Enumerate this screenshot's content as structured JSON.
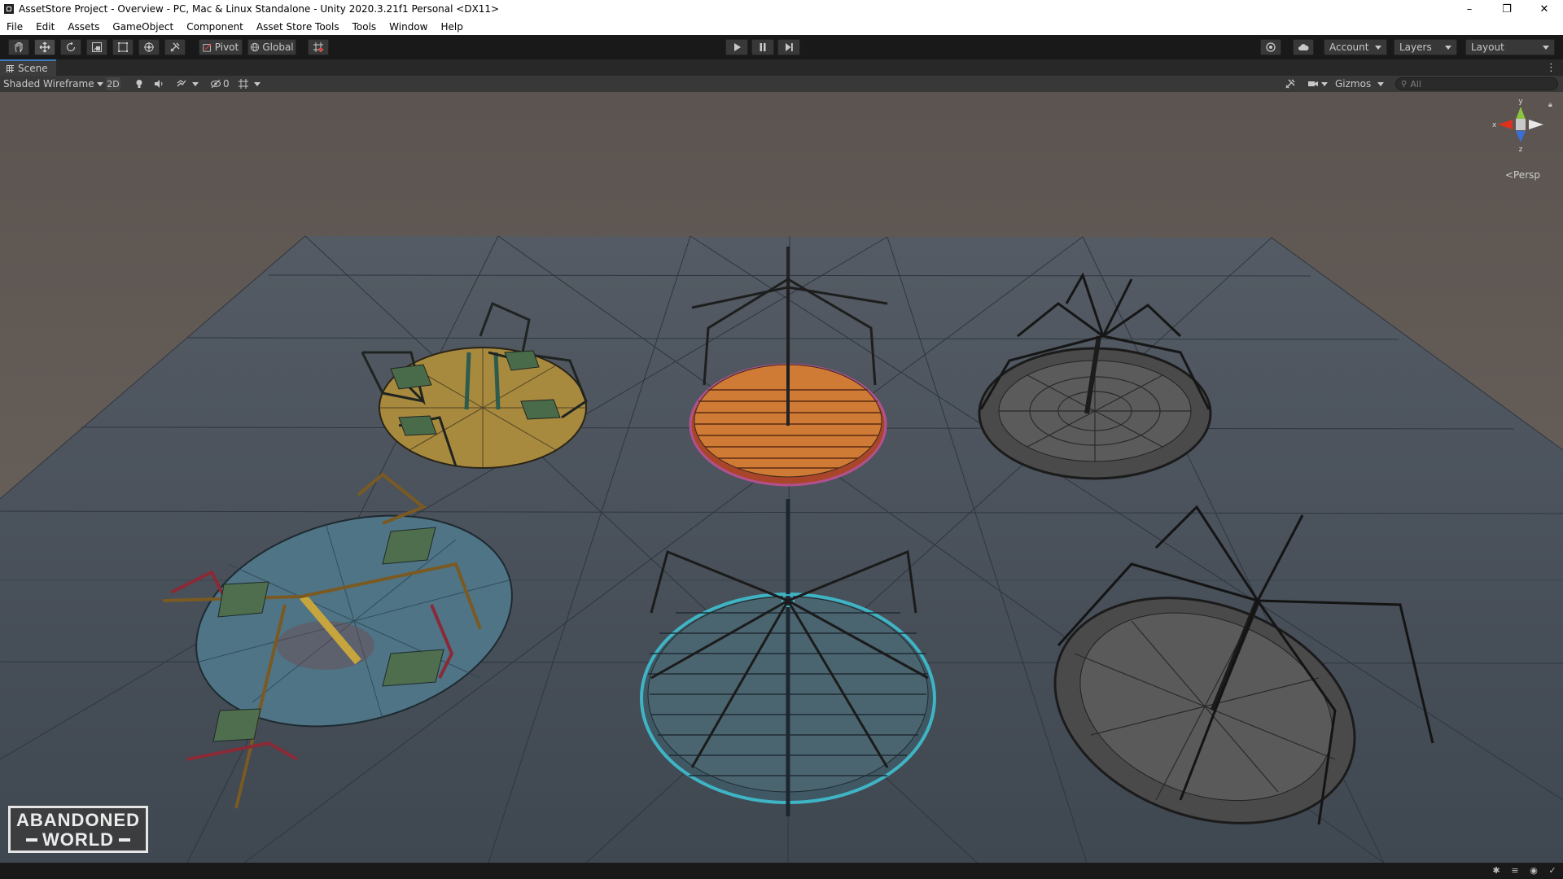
{
  "window": {
    "title": "AssetStore Project - Overview - PC, Mac & Linux Standalone - Unity 2020.3.21f1 Personal <DX11>",
    "controls": {
      "minimize": "–",
      "maximize": "❐",
      "close": "✕"
    }
  },
  "menu": {
    "items": [
      "File",
      "Edit",
      "Assets",
      "GameObject",
      "Component",
      "Asset Store Tools",
      "Tools",
      "Window",
      "Help"
    ]
  },
  "toolbar": {
    "tools": [
      "hand-icon",
      "move-icon",
      "rotate-icon",
      "scale-icon",
      "rect-icon",
      "transform-icon",
      "custom-tool-icon"
    ],
    "pivot_label": "Pivot",
    "global_label": "Global",
    "account_label": "Account",
    "layers_label": "Layers",
    "layout_label": "Layout"
  },
  "scene": {
    "tab_label": "Scene",
    "draw_mode": "Shaded Wireframe",
    "mode_2d": "2D",
    "hidden_count": "0",
    "gizmos_label": "Gizmos",
    "search_placeholder": "All",
    "projection_label": "Persp",
    "axes": {
      "x": "x",
      "y": "y",
      "z": "z"
    }
  },
  "watermark": {
    "line1": "ABANDONED",
    "line2": "WORLD"
  },
  "colors": {
    "accent": "#3a79bb",
    "sky": "#6a625c",
    "ground": "#4c5561",
    "axis_x": "#e0301e",
    "axis_y": "#8bc53f",
    "axis_z": "#3a6fd8"
  }
}
